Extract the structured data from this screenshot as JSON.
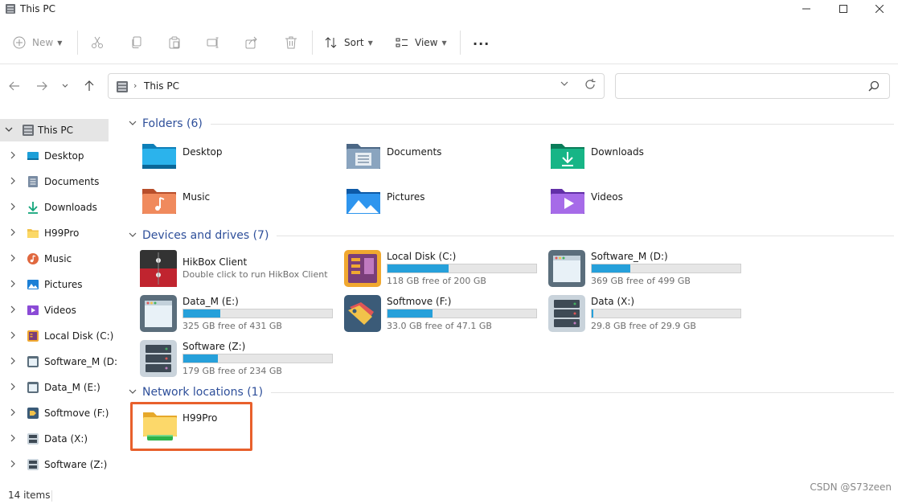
{
  "window": {
    "title": "This PC"
  },
  "toolbar": {
    "new_label": "New",
    "sort_label": "Sort",
    "view_label": "View",
    "more_label": "..."
  },
  "address": {
    "crumb": "This PC"
  },
  "search": {
    "placeholder": "",
    "value": ""
  },
  "sidebar": {
    "items": [
      {
        "label": "This PC",
        "icon": "this-pc-icon"
      },
      {
        "label": "Desktop",
        "icon": "desktop-icon"
      },
      {
        "label": "Documents",
        "icon": "documents-icon"
      },
      {
        "label": "Downloads",
        "icon": "downloads-icon"
      },
      {
        "label": "H99Pro",
        "icon": "folder-icon"
      },
      {
        "label": "Music",
        "icon": "music-icon"
      },
      {
        "label": "Pictures",
        "icon": "pictures-icon"
      },
      {
        "label": "Videos",
        "icon": "videos-icon"
      },
      {
        "label": "Local Disk (C:)",
        "icon": "local-disk-icon"
      },
      {
        "label": "Software_M (D:",
        "icon": "window-drive-icon"
      },
      {
        "label": "Data_M (E:)",
        "icon": "window-drive-icon"
      },
      {
        "label": "Softmove (F:)",
        "icon": "tags-drive-icon"
      },
      {
        "label": "Data (X:)",
        "icon": "server-drive-icon"
      },
      {
        "label": "Software (Z:)",
        "icon": "server-drive-icon"
      }
    ]
  },
  "sections": {
    "folders": "Folders (6)",
    "drives": "Devices and drives (7)",
    "network": "Network locations (1)"
  },
  "folders": [
    {
      "label": "Desktop",
      "icon": "desktop-folder-icon",
      "color": "#1d9fd8"
    },
    {
      "label": "Documents",
      "icon": "documents-folder-icon",
      "color": "#5f7e9e"
    },
    {
      "label": "Downloads",
      "icon": "downloads-folder-icon",
      "color": "#12a57a"
    },
    {
      "label": "Music",
      "icon": "music-folder-icon",
      "color": "#e0683f"
    },
    {
      "label": "Pictures",
      "icon": "pictures-folder-icon",
      "color": "#1b7fd6"
    },
    {
      "label": "Videos",
      "icon": "videos-folder-icon",
      "color": "#8b4bd6"
    }
  ],
  "drives": [
    {
      "name": "HikBox Client",
      "subtitle": "Double click to run HikBox Client",
      "icon": "hikbox-icon"
    },
    {
      "name": "Local Disk (C:)",
      "free": "118 GB free of 200 GB",
      "used_fraction": 0.41,
      "icon": "local-disk-icon"
    },
    {
      "name": "Software_M (D:)",
      "free": "369 GB free of 499 GB",
      "used_fraction": 0.26,
      "icon": "window-drive-icon"
    },
    {
      "name": "Data_M (E:)",
      "free": "325 GB free of 431 GB",
      "used_fraction": 0.25,
      "icon": "window-drive-icon"
    },
    {
      "name": "Softmove (F:)",
      "free": "33.0 GB free of 47.1 GB",
      "used_fraction": 0.3,
      "icon": "tags-drive-icon"
    },
    {
      "name": "Data (X:)",
      "free": "29.8 GB free of 29.9 GB",
      "used_fraction": 0.01,
      "icon": "server-drive-icon"
    },
    {
      "name": "Software (Z:)",
      "free": "179 GB free of 234 GB",
      "used_fraction": 0.23,
      "icon": "server-drive-icon"
    }
  ],
  "network": [
    {
      "label": "H99Pro",
      "icon": "network-folder-icon"
    }
  ],
  "status": {
    "count": "14 items",
    "watermark": "CSDN @S73zeen"
  },
  "colors": {
    "accent": "#2e4f9a",
    "bar": "#26a0da",
    "highlight": "#e8602c"
  }
}
